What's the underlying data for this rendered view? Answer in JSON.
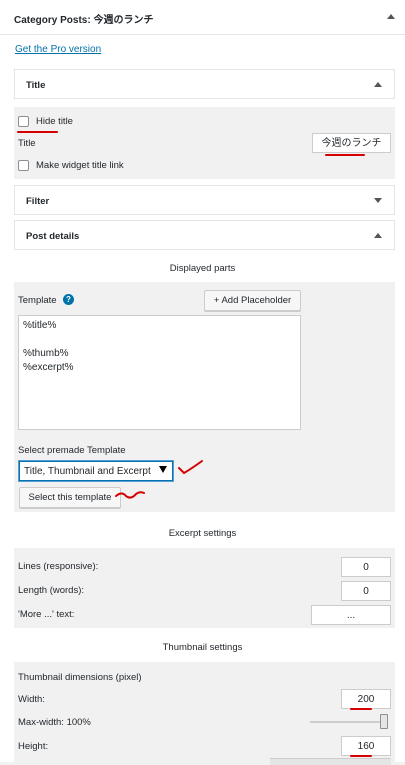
{
  "widget": {
    "title": "Category Posts: 今週のランチ",
    "pro_link": "Get the Pro version"
  },
  "title_section": {
    "heading": "Title",
    "hide_title_label": "Hide title",
    "title_label": "Title",
    "title_value": "今週のランチ",
    "make_link_label": "Make widget title link"
  },
  "filter_section": {
    "heading": "Filter"
  },
  "post_details": {
    "heading": "Post details",
    "displayed_parts": "Displayed parts",
    "template_label": "Template",
    "add_placeholder": "+ Add Placeholder",
    "template_value": "%title%\n\n%thumb%\n%excerpt%",
    "premade_label": "Select premade Template",
    "premade_selected": "Title, Thumbnail and Excerpt",
    "select_template_button": "Select this template"
  },
  "excerpt_settings": {
    "heading": "Excerpt settings",
    "lines_label": "Lines (responsive):",
    "lines_value": "0",
    "length_label": "Length (words):",
    "length_value": "0",
    "more_label": "'More ...' text:",
    "more_value": "..."
  },
  "thumbnail_settings": {
    "heading": "Thumbnail settings",
    "dimensions_label": "Thumbnail dimensions (pixel)",
    "width_label": "Width:",
    "width_value": "200",
    "maxwidth_label": "Max-width: 100%",
    "maxwidth_slider_fraction": 1.0,
    "height_label": "Height:",
    "height_value": "160"
  },
  "colors": {
    "link": "#0073aa",
    "annotation_red": "#d40000",
    "panel_gray": "#f1f1f1"
  }
}
